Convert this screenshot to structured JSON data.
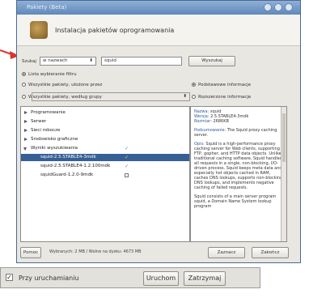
{
  "window": {
    "title": "Pakiety (Beta)",
    "heading": "Instalacja pakietów oprogramowania"
  },
  "search": {
    "label": "Szukaj",
    "scope_value": "w nazwach",
    "query_value": "squid",
    "button_label": "Wyszukaj"
  },
  "filters": {
    "option_1": "Lista wybieranie filtru",
    "option_2": "Wszystkie pakiety, ułożone przez",
    "option_3": "Wszystkie pakiety, według grupy",
    "right_option_1": "Podstawowe informacje",
    "right_option_2": "Rozszerzone informacje"
  },
  "tree": {
    "items": [
      {
        "label": "Programowanie",
        "expanded": false,
        "indent": 0,
        "selected": false,
        "mark": ""
      },
      {
        "label": "Serwer",
        "expanded": false,
        "indent": 0,
        "selected": false,
        "mark": ""
      },
      {
        "label": "Sieci robocze",
        "expanded": false,
        "indent": 0,
        "selected": false,
        "mark": ""
      },
      {
        "label": "Środowisko graficzne",
        "expanded": false,
        "indent": 0,
        "selected": false,
        "mark": ""
      },
      {
        "label": "Wyniki wyszukiwania",
        "expanded": true,
        "indent": 0,
        "selected": false,
        "mark": "check"
      },
      {
        "label": "squid-2.5.STABLE4-3mdk",
        "expanded": false,
        "indent": 1,
        "selected": true,
        "mark": "check"
      },
      {
        "label": "squid-2.5.STABLE4-1.2.100mdk",
        "expanded": false,
        "indent": 1,
        "selected": false,
        "mark": "check"
      },
      {
        "label": "squidGuard-1.2.0-9mdk",
        "expanded": false,
        "indent": 1,
        "selected": false,
        "mark": "box"
      }
    ]
  },
  "info": {
    "name_key": "Nazwa:",
    "name_val": "squid",
    "version_key": "Wersja:",
    "version_val": "2.5.STABLE4-3mdk",
    "size_key": "Rozmiar:",
    "size_val": "2686KB",
    "summary_key": "Podsumowanie:",
    "summary_val": "The Squid proxy caching server.",
    "desc_key": "Opis:",
    "desc_val": "Squid is a high-performance proxy caching server for Web clients, supporting FTP, gopher, and HTTP data objects. Unlike traditional caching software, Squid handles all requests in a single, non-blocking, I/O-driven process. Squid keeps meta data and especially hot objects cached in RAM, caches DNS lookups, supports non-blocking DNS lookups, and implements negative caching of failed requests.",
    "desc2_val": "Squid consists of a main server program squid, a Domain Name System lookup program"
  },
  "footer": {
    "help_label": "Pomoc",
    "status_text": "Wybranych: 2 MB / Wolne na dysku: 4673 MB",
    "select_label": "Zaznacz",
    "close_label": "Zakończ"
  },
  "bottombar": {
    "checkbox_label": "Przy uruchamianiu",
    "run_label": "Uruchom",
    "stop_label": "Zatrzymaj"
  }
}
